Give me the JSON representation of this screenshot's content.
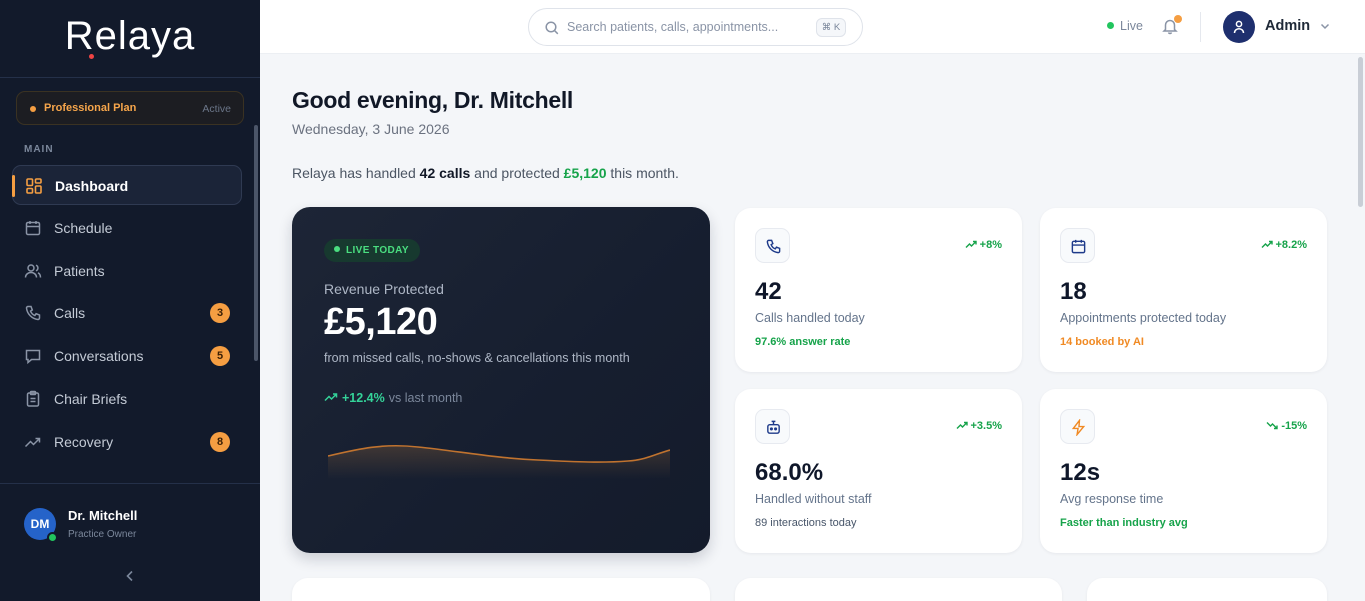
{
  "brand": {
    "name": "Relaya"
  },
  "plan": {
    "name": "Professional Plan",
    "status": "Active"
  },
  "sidebar": {
    "section_label": "MAIN",
    "items": [
      {
        "label": "Dashboard",
        "icon": "dashboard-icon",
        "active": true,
        "badge": null
      },
      {
        "label": "Schedule",
        "icon": "calendar-icon",
        "badge": null
      },
      {
        "label": "Patients",
        "icon": "users-icon",
        "badge": null
      },
      {
        "label": "Calls",
        "icon": "phone-icon",
        "badge": "3"
      },
      {
        "label": "Conversations",
        "icon": "message-icon",
        "badge": "5"
      },
      {
        "label": "Chair Briefs",
        "icon": "clipboard-icon",
        "badge": null
      },
      {
        "label": "Recovery",
        "icon": "trend-up-icon",
        "badge": "8"
      }
    ],
    "user": {
      "initials": "DM",
      "name": "Dr. Mitchell",
      "role": "Practice Owner"
    }
  },
  "topbar": {
    "search_placeholder": "Search patients, calls, appointments...",
    "shortcut": "⌘ K",
    "live_label": "Live",
    "admin_name": "Admin"
  },
  "header": {
    "greeting": "Good evening, Dr. Mitchell",
    "date": "Wednesday, 3 June 2026",
    "summary_prefix": "Relaya has handled ",
    "summary_calls": "42 calls",
    "summary_mid": " and protected ",
    "summary_amount": "£5,120",
    "summary_suffix": " this month."
  },
  "revenue": {
    "pill": "LIVE TODAY",
    "label": "Revenue Protected",
    "value": "£5,120",
    "sub": "from missed calls, no-shows & cancellations this month",
    "trend_value": "+12.4%",
    "trend_label": "vs last month"
  },
  "stats": [
    {
      "icon": "phone-icon",
      "change": "+8%",
      "value": "42",
      "label": "Calls handled today",
      "foot": "97.6% answer rate",
      "foot_color": "green"
    },
    {
      "icon": "calendar-icon",
      "change": "+8.2%",
      "value": "18",
      "label": "Appointments protected today",
      "foot": "14 booked by AI",
      "foot_color": "orange"
    },
    {
      "icon": "bot-icon",
      "change": "+3.5%",
      "value": "68.0%",
      "label": "Handled without staff",
      "foot": "89 interactions today",
      "foot_color": "gray"
    },
    {
      "icon": "lightning-icon",
      "change": "-15%",
      "value": "12s",
      "label": "Avg response time",
      "foot": "Faster than industry avg",
      "foot_color": "green"
    }
  ],
  "colors": {
    "sidebar_bg": "#121a2b",
    "accent": "#f59e42",
    "success": "#16a34a"
  }
}
